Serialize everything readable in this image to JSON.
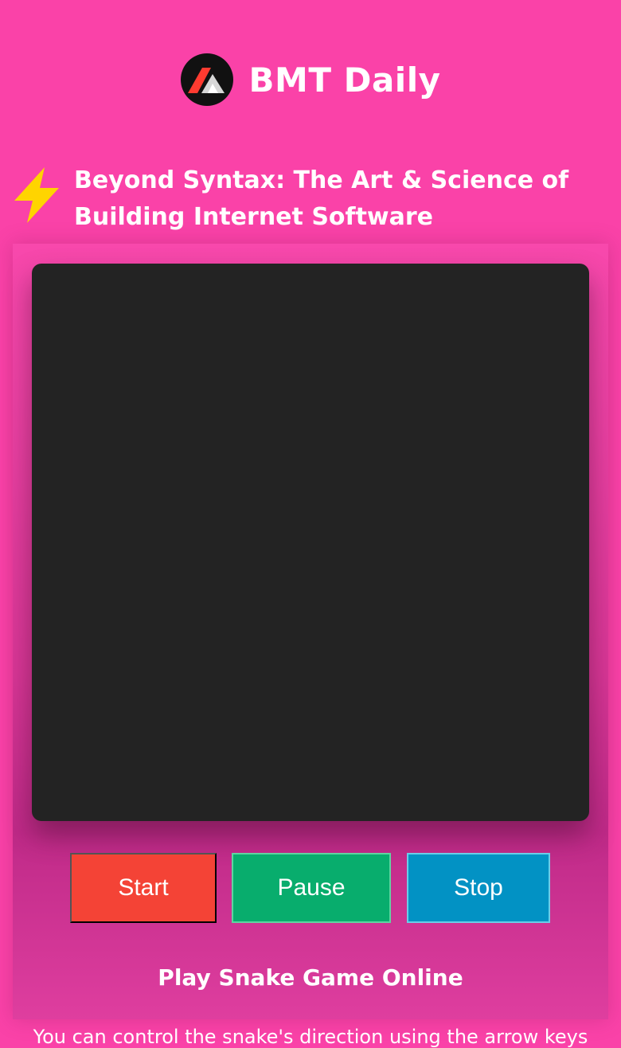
{
  "site": {
    "name": "BMT Daily",
    "logo_icon": "bmt-logo",
    "colors": {
      "background": "#fa42a8",
      "canvas": "#232323",
      "start": "#f44336",
      "pause": "#08ad6d",
      "stop": "#0292c4"
    }
  },
  "headline": {
    "icon": "lightning-bolt-icon",
    "line1": "Beyond Syntax: The Art & Science of",
    "line2": "Building Internet Software"
  },
  "game": {
    "controls": {
      "start_label": "Start",
      "pause_label": "Pause",
      "stop_label": "Stop"
    },
    "title": "Play Snake Game Online",
    "description": "You can control the snake's direction using the arrow keys"
  }
}
